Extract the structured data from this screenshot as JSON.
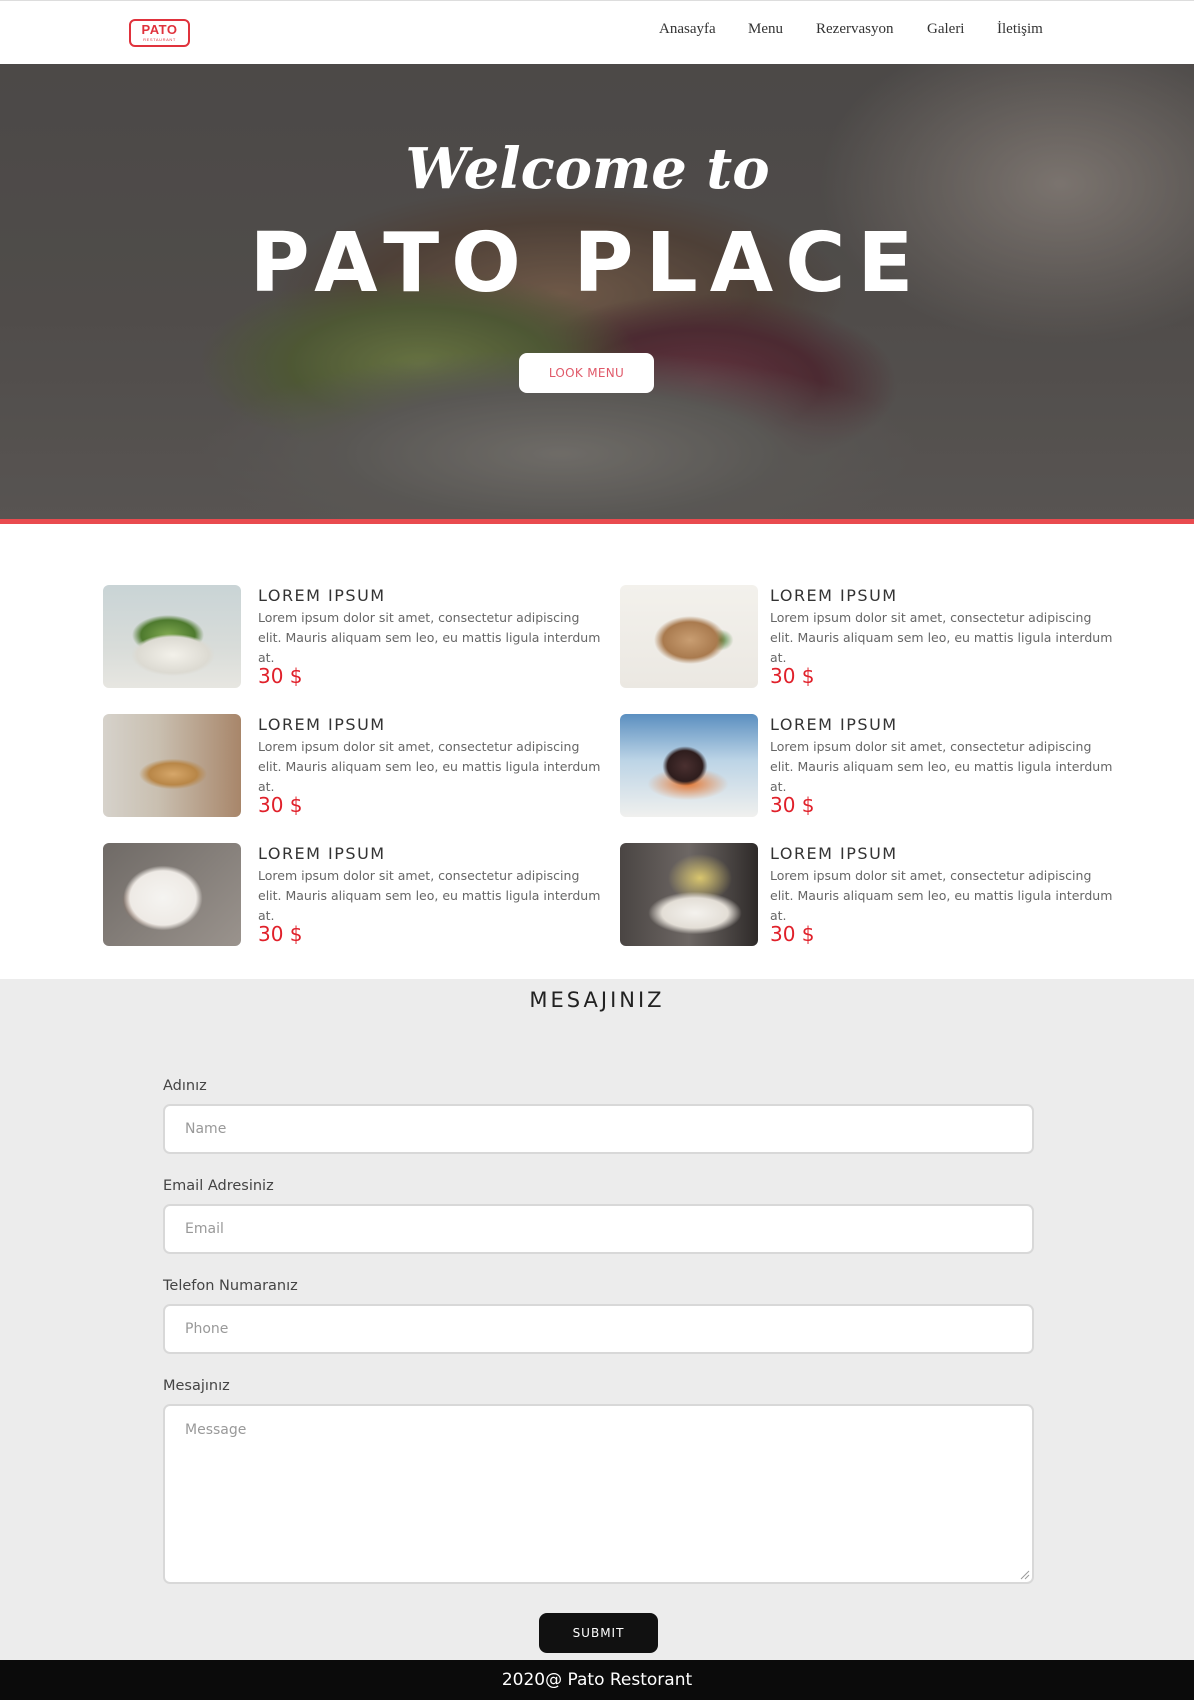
{
  "brand": {
    "logo_main": "PATO",
    "logo_sub": "RESTAURANT",
    "accent": "#e0323c"
  },
  "nav": {
    "items": [
      {
        "label": "Anasayfa"
      },
      {
        "label": "Menu"
      },
      {
        "label": "Rezervasyon"
      },
      {
        "label": "Galeri"
      },
      {
        "label": "İletişim"
      }
    ]
  },
  "hero": {
    "line1": "Welcome to",
    "line2": "PATO PLACE",
    "button_label": "LOOK MENU",
    "bar_color": "#e94b4f"
  },
  "menu": {
    "items": [
      {
        "title": "LOREM IPSUM",
        "desc": "Lorem ipsum dolor sit amet, consectetur adipiscing elit. Mauris aliquam sem leo, eu mattis ligula interdum at.",
        "price": "30 $",
        "image": "salad-photo"
      },
      {
        "title": "LOREM IPSUM",
        "desc": "Lorem ipsum dolor sit amet, consectetur adipiscing elit. Mauris aliquam sem leo, eu mattis ligula interdum at.",
        "price": "30 $",
        "image": "steak-photo"
      },
      {
        "title": "LOREM IPSUM",
        "desc": "Lorem ipsum dolor sit amet, consectetur adipiscing elit. Mauris aliquam sem leo, eu mattis ligula interdum at.",
        "price": "30 $",
        "image": "bread-table-photo"
      },
      {
        "title": "LOREM IPSUM",
        "desc": "Lorem ipsum dolor sit amet, consectetur adipiscing elit. Mauris aliquam sem leo, eu mattis ligula interdum at.",
        "price": "30 $",
        "image": "meat-dish-photo"
      },
      {
        "title": "LOREM IPSUM",
        "desc": "Lorem ipsum dolor sit amet, consectetur adipiscing elit. Mauris aliquam sem leo, eu mattis ligula interdum at.",
        "price": "30 $",
        "image": "shrimp-plate-photo"
      },
      {
        "title": "LOREM IPSUM",
        "desc": "Lorem ipsum dolor sit amet, consectetur adipiscing elit. Mauris aliquam sem leo, eu mattis ligula interdum at.",
        "price": "30 $",
        "image": "champagne-glasses-photo"
      }
    ],
    "price_color": "#e0202a"
  },
  "contact": {
    "title": "MESAJINIZ",
    "fields": {
      "name": {
        "label": "Adınız",
        "placeholder": "Name"
      },
      "email": {
        "label": "Email Adresiniz",
        "placeholder": "Email"
      },
      "phone": {
        "label": "Telefon Numaranız",
        "placeholder": "Phone"
      },
      "message": {
        "label": "Mesajınız",
        "placeholder": "Message"
      }
    },
    "submit_label": "SUBMIT"
  },
  "footer": {
    "text": "2020@ Pato Restorant"
  }
}
